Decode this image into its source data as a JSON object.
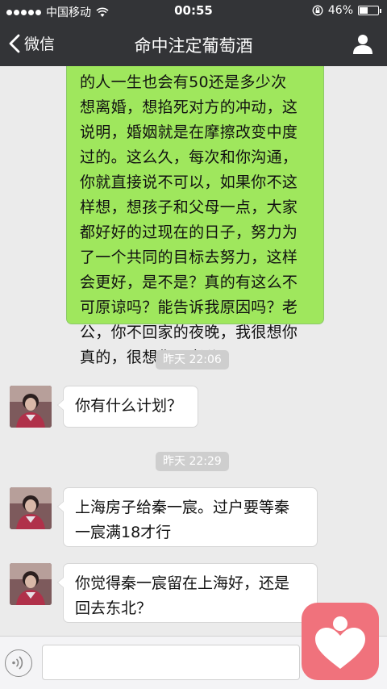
{
  "status_bar": {
    "carrier": "中国移动",
    "time": "00:55",
    "battery_percent": "46%",
    "battery_level": 0.46,
    "signal_bars_filled": 5
  },
  "nav": {
    "back_label": "微信",
    "title": "命中注定葡萄酒"
  },
  "messages": {
    "sent_1": {
      "lines": [
        "的人一生也会有50还是多少次",
        "想离婚，想掐死对方的冲动，这",
        "说明，婚姻就是在摩擦改变中度",
        "过的。这么久，每次和你沟通，",
        "你就直接说不可以，如果你不这",
        "样想，想孩子和父母一点，大家",
        "都好好的过现在的日子，努力为",
        "了一个共同的目标去努力，这样",
        "会更好，是不是？真的有这么不",
        "可原谅吗？能告诉我原因吗？老",
        "公，你不回家的夜晚，我很想你",
        "真的，很想你，老公"
      ]
    },
    "time_1": "昨天 22:06",
    "recv_1": {
      "lines": [
        "你有什么计划？"
      ]
    },
    "time_2": "昨天 22:29",
    "recv_2": {
      "lines": [
        "上海房子给秦一宸。过户要等秦",
        "一宸满18才行"
      ]
    },
    "recv_3": {
      "lines": [
        "你觉得秦一宸留在上海好，还是",
        "回去东北？"
      ]
    }
  },
  "input": {
    "value": ""
  },
  "colors": {
    "nav_bg": "#333437",
    "sent_bubble": "#9fe75d",
    "chat_bg": "#ebebeb",
    "app_logo": "#f0727c"
  },
  "icons": {
    "back": "chevron-left-icon",
    "profile": "person-icon",
    "voice": "voice-icon",
    "wifi": "wifi-icon",
    "lock": "rotation-lock-icon",
    "battery": "battery-icon",
    "logo": "heart-person-logo"
  }
}
